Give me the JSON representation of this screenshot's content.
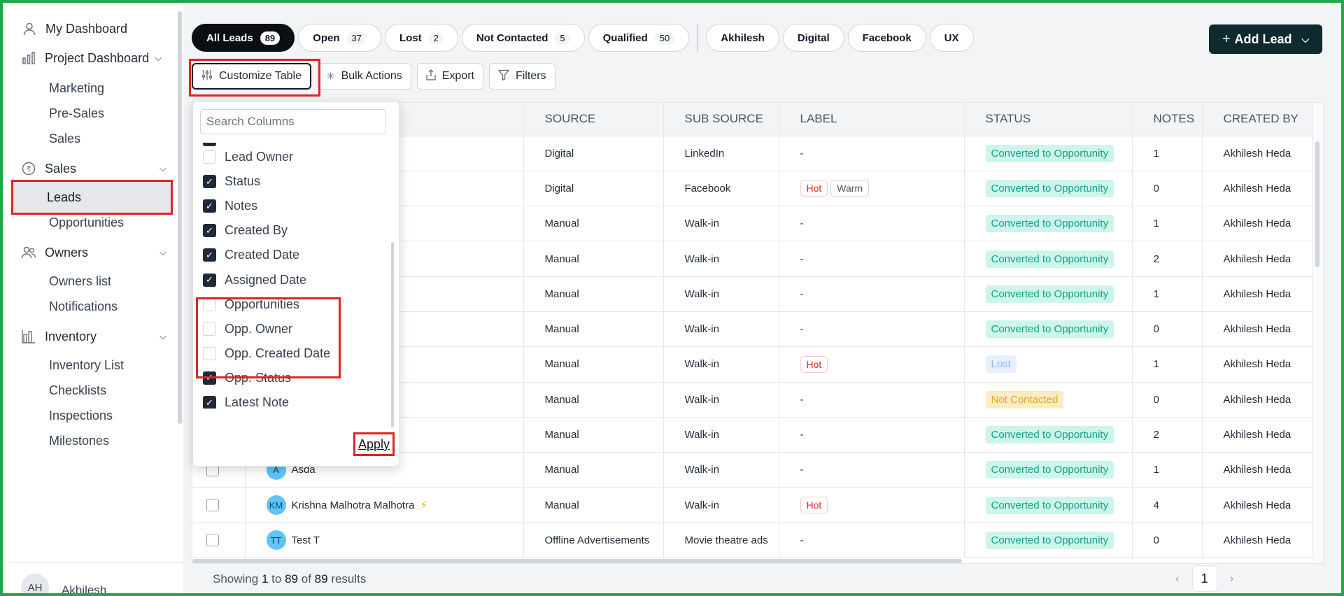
{
  "sidebar": {
    "dashboard": "My Dashboard",
    "project_dashboard": "Project Dashboard",
    "project_children": [
      "Marketing",
      "Pre-Sales",
      "Sales"
    ],
    "sales": "Sales",
    "leads": "Leads",
    "opportunities": "Opportunities",
    "owners": "Owners",
    "owners_children": [
      "Owners list",
      "Notifications"
    ],
    "inventory": "Inventory",
    "inventory_children": [
      "Inventory List",
      "Checklists",
      "Inspections",
      "Milestones"
    ],
    "user_initials": "AH",
    "user_name": "Akhilesh"
  },
  "filters": {
    "chips": [
      {
        "label": "All Leads",
        "count": "89"
      },
      {
        "label": "Open",
        "count": "37"
      },
      {
        "label": "Lost",
        "count": "2"
      },
      {
        "label": "Not Contacted",
        "count": "5"
      },
      {
        "label": "Qualified",
        "count": "50"
      }
    ],
    "tags": [
      "Akhilesh",
      "Digital",
      "Facebook",
      "UX"
    ]
  },
  "add_lead": "Add Lead",
  "toolbar": {
    "customize": "Customize Table",
    "bulk": "Bulk Actions",
    "export": "Export",
    "filters": "Filters"
  },
  "table": {
    "headers": [
      "SOURCE",
      "SUB SOURCE",
      "LABEL",
      "STATUS",
      "NOTES",
      "CREATED BY"
    ],
    "rows": [
      {
        "initials": "",
        "name": "",
        "source": "Digital",
        "sub": "LinkedIn",
        "labels": [],
        "status": "Converted to Opportunity",
        "notes": "1",
        "by": "Akhilesh Heda"
      },
      {
        "initials": "",
        "name": "",
        "source": "Digital",
        "sub": "Facebook",
        "labels": [
          "Hot",
          "Warm"
        ],
        "status": "Converted to Opportunity",
        "notes": "0",
        "by": "Akhilesh Heda"
      },
      {
        "initials": "",
        "name": "",
        "source": "Manual",
        "sub": "Walk-in",
        "labels": [],
        "status": "Converted to Opportunity",
        "notes": "1",
        "by": "Akhilesh Heda"
      },
      {
        "initials": "",
        "name": "",
        "source": "Manual",
        "sub": "Walk-in",
        "labels": [],
        "status": "Converted to Opportunity",
        "notes": "2",
        "by": "Akhilesh Heda"
      },
      {
        "initials": "",
        "name": "",
        "source": "Manual",
        "sub": "Walk-in",
        "labels": [],
        "status": "Converted to Opportunity",
        "notes": "1",
        "by": "Akhilesh Heda"
      },
      {
        "initials": "",
        "name": "",
        "source": "Manual",
        "sub": "Walk-in",
        "labels": [],
        "status": "Converted to Opportunity",
        "notes": "0",
        "by": "Akhilesh Heda"
      },
      {
        "initials": "",
        "name": "",
        "source": "Manual",
        "sub": "Walk-in",
        "labels": [
          "Hot"
        ],
        "status": "Lost",
        "notes": "1",
        "by": "Akhilesh Heda"
      },
      {
        "initials": "",
        "name": "",
        "source": "Manual",
        "sub": "Walk-in",
        "labels": [],
        "status": "Not Contacted",
        "notes": "0",
        "by": "Akhilesh Heda"
      },
      {
        "initials": "",
        "name": "",
        "source": "Manual",
        "sub": "Walk-in",
        "labels": [],
        "status": "Converted to Opportunity",
        "notes": "2",
        "by": "Akhilesh Heda"
      },
      {
        "initials": "A",
        "name": "Asda",
        "source": "Manual",
        "sub": "Walk-in",
        "labels": [],
        "status": "Converted to Opportunity",
        "notes": "1",
        "by": "Akhilesh Heda"
      },
      {
        "initials": "KM",
        "name": "Krishna Malhotra Malhotra",
        "bolt": true,
        "source": "Manual",
        "sub": "Walk-in",
        "labels": [
          "Hot"
        ],
        "status": "Converted to Opportunity",
        "notes": "4",
        "by": "Akhilesh Heda"
      },
      {
        "initials": "TT",
        "name": "Test T",
        "source": "Offline Advertisements",
        "sub": "Movie theatre ads",
        "labels": [],
        "status": "Converted to Opportunity",
        "notes": "0",
        "by": "Akhilesh Heda"
      }
    ],
    "empty_label": "-"
  },
  "status_colors": {
    "Converted to Opportunity": {
      "bg": "#ccf5ec",
      "fg": "#16a085"
    },
    "Lost": {
      "bg": "#e6f0ff",
      "fg": "#93b4e8"
    },
    "Not Contacted": {
      "bg": "#fdecc2",
      "fg": "#e3a52a"
    }
  },
  "footer": {
    "showing": "Showing",
    "from": "1",
    "to_word": "to",
    "to": "89",
    "of_word": "of",
    "total": "89",
    "results": "results",
    "page": "1"
  },
  "customize_popover": {
    "search_placeholder": "Search Columns",
    "columns": [
      {
        "label": "Lead Owner",
        "checked": false
      },
      {
        "label": "Status",
        "checked": true
      },
      {
        "label": "Notes",
        "checked": true
      },
      {
        "label": "Created By",
        "checked": true
      },
      {
        "label": "Created Date",
        "checked": true
      },
      {
        "label": "Assigned Date",
        "checked": true
      },
      {
        "label": "Opportunities",
        "checked": false
      },
      {
        "label": "Opp. Owner",
        "checked": false
      },
      {
        "label": "Opp. Created Date",
        "checked": false
      },
      {
        "label": "Opp. Status",
        "checked": true
      },
      {
        "label": "Latest Note",
        "checked": true
      }
    ],
    "apply": "Apply"
  },
  "colors": {
    "accent_dark": "#0f2a2e",
    "highlight_red": "#dc2626",
    "frame_green": "#22a845"
  }
}
